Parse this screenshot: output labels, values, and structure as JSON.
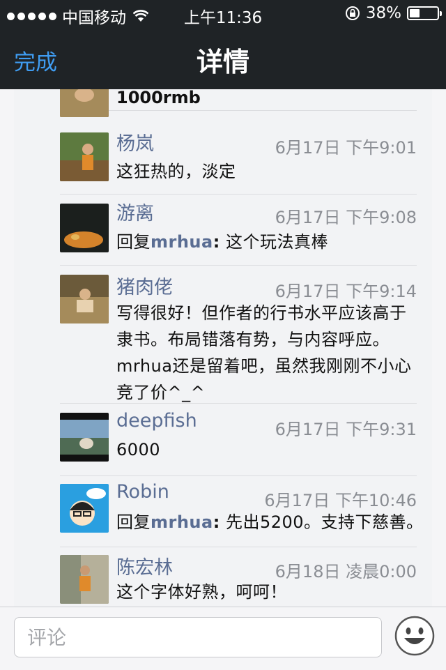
{
  "status_bar": {
    "carrier": "中国移动",
    "time": "上午11:36",
    "battery_percent_label": "38%",
    "battery_level": 0.38
  },
  "nav": {
    "back_label": "完成",
    "title": "详情"
  },
  "first_comment_text": "1000rmb",
  "comments": [
    {
      "name": "杨岚",
      "time": "6月17日  下午9:01",
      "text": "这狂热的，淡定"
    },
    {
      "name": "游离",
      "time": "6月17日  下午9:08",
      "reply_prefix": "回复",
      "reply_to": "mrhua",
      "sep": ":",
      "text": " 这个玩法真棒"
    },
    {
      "name": "猪肉佬",
      "time": "6月17日  下午9:14",
      "text": "写得很好！但作者的行书水平应该高于隶书。布局错落有势，与内容呼应。mrhua还是留着吧，虽然我刚刚不小心竞了价^_^"
    },
    {
      "name": "deepfish",
      "time": "6月17日  下午9:31",
      "text": "6000"
    },
    {
      "name": "Robin",
      "time": "6月17日  下午10:46",
      "reply_prefix": "回复",
      "reply_to": "mrhua",
      "sep": ":",
      "text": " 先出5200。支持下慈善。"
    },
    {
      "name": "陈宏林",
      "time": "6月18日  凌晨0:00",
      "text": "这个字体好熟，呵呵！"
    }
  ],
  "input": {
    "placeholder": "评论"
  },
  "colors": {
    "nav_bg": "#1f2326",
    "accent_blue": "#3f9cf1",
    "name_color": "#5a6d93"
  }
}
